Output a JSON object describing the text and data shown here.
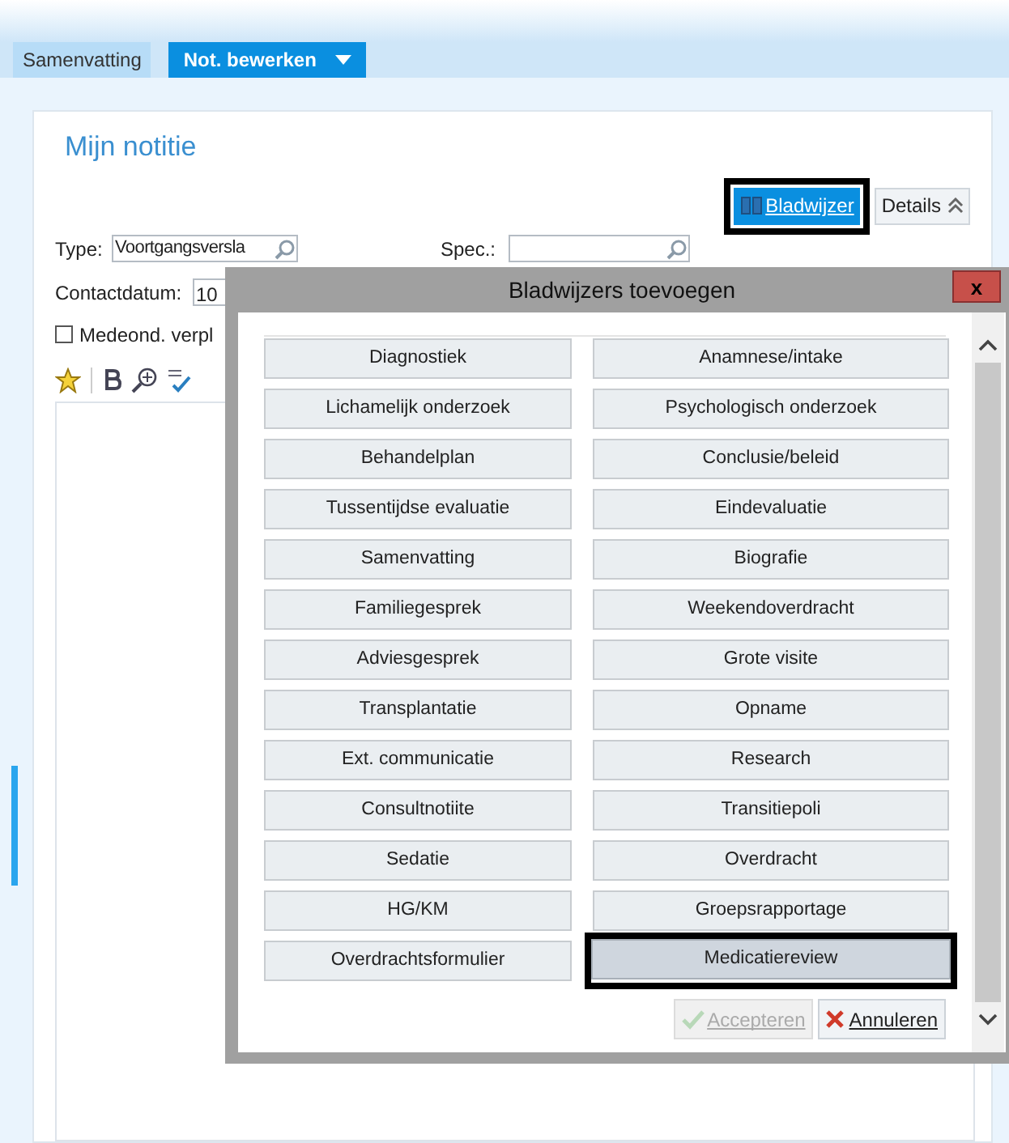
{
  "tabs": [
    {
      "label": "Samenvatting",
      "selected": false,
      "dropdown": false
    },
    {
      "label": "Not. bewerken",
      "selected": true,
      "dropdown": true
    }
  ],
  "note": {
    "title": "Mijn notitie",
    "actions": [
      {
        "kind": "primary",
        "label": "Bladwijzer",
        "highlighted": true
      },
      {
        "kind": "toggle",
        "label": "Details",
        "highlighted": false
      }
    ],
    "type_label": "Type:",
    "type_value": "Voortgangsversla",
    "spec_label": "Spec.:",
    "date_label": "Contactdatum:",
    "date_value": "10",
    "checkbox": {
      "label": "Medeond. verpl",
      "checked": false
    }
  },
  "dialog": {
    "title": "Bladwijzers toevoegen",
    "close": "x",
    "bookmarks": [
      {
        "label": "Diagnostiek",
        "selected": false
      },
      {
        "label": "Anamnese/intake",
        "selected": false
      },
      {
        "label": "Lichamelijk onderzoek",
        "selected": false
      },
      {
        "label": "Psychologisch onderzoek",
        "selected": false
      },
      {
        "label": "Behandelplan",
        "selected": false
      },
      {
        "label": "Conclusie/beleid",
        "selected": false
      },
      {
        "label": "Tussentijdse evaluatie",
        "selected": false
      },
      {
        "label": "Eindevaluatie",
        "selected": false
      },
      {
        "label": "Samenvatting",
        "selected": false
      },
      {
        "label": "Biografie",
        "selected": false
      },
      {
        "label": "Familiegesprek",
        "selected": false
      },
      {
        "label": "Weekendoverdracht",
        "selected": false
      },
      {
        "label": "Adviesgesprek",
        "selected": false
      },
      {
        "label": "Grote visite",
        "selected": false
      },
      {
        "label": "Transplantatie",
        "selected": false
      },
      {
        "label": "Opname",
        "selected": false
      },
      {
        "label": "Ext. communicatie",
        "selected": false
      },
      {
        "label": "Research",
        "selected": false
      },
      {
        "label": "Consultnotiite",
        "selected": false
      },
      {
        "label": "Transitiepoli",
        "selected": false
      },
      {
        "label": "Sedatie",
        "selected": false
      },
      {
        "label": "Overdracht",
        "selected": false
      },
      {
        "label": "HG/KM",
        "selected": false
      },
      {
        "label": "Groepsrapportage",
        "selected": false
      },
      {
        "label": "Overdrachtsformulier",
        "selected": false
      },
      {
        "label": "Medicatiereview",
        "selected": true
      }
    ],
    "buttons": [
      {
        "kind": "accept",
        "label": "Accepteren",
        "disabled": true
      },
      {
        "kind": "cancel",
        "label": "Annuleren",
        "disabled": false
      }
    ]
  }
}
